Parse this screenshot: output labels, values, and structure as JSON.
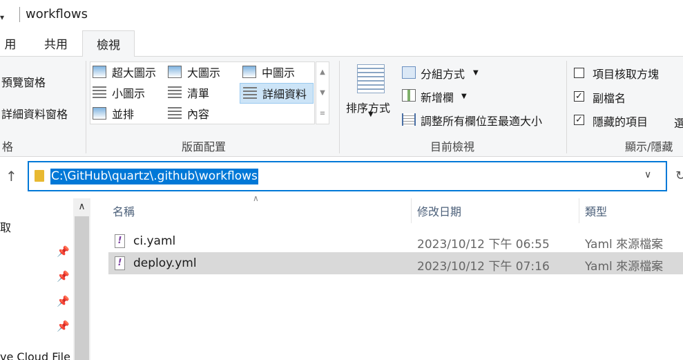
{
  "window": {
    "title": "workflows",
    "qa_dropdown": "▾"
  },
  "tabs": [
    {
      "label": "用"
    },
    {
      "label": "共用"
    },
    {
      "label": "檢視",
      "selected": true
    }
  ],
  "ribbon": {
    "panes": {
      "preview_pane": "預覽窗格",
      "details_pane": "詳細資料窗格",
      "group_label": "格"
    },
    "layout": {
      "items": [
        "超大圖示",
        "大圖示",
        "中圖示",
        "小圖示",
        "清單",
        "詳細資料",
        "並排",
        "內容"
      ],
      "selected": "詳細資料",
      "group_label": "版面配置"
    },
    "current_view": {
      "sort_by": "排序方式",
      "group_by": "分組方式",
      "add_columns": "新增欄",
      "size_all_columns": "調整所有欄位至最適大小",
      "group_label": "目前檢視"
    },
    "show_hide": {
      "item_checkboxes": {
        "label": "項目核取方塊",
        "checked": false
      },
      "file_name_extensions": {
        "label": "副檔名",
        "checked": true
      },
      "hidden_items": {
        "label": "隱藏的項目",
        "checked": true
      },
      "partial_label": "選",
      "group_label": "顯示/隱藏"
    }
  },
  "address_bar": {
    "path": "C:\\GitHub\\quartz\\.github\\workflows"
  },
  "nav_pane": {
    "partial_item": "取",
    "cloud_item": "ve Cloud File"
  },
  "file_list": {
    "columns": [
      "名稱",
      "修改日期",
      "類型"
    ],
    "rows": [
      {
        "name": "ci.yaml",
        "modified": "2023/10/12 下午 06:55",
        "type": "Yaml 來源檔案"
      },
      {
        "name": "deploy.yml",
        "modified": "2023/10/12 下午 07:16",
        "type": "Yaml 來源檔案",
        "selected": true
      }
    ]
  },
  "colors": {
    "accent": "#0078d7",
    "selection": "#cce4f7",
    "row_highlight": "#d9d9d9"
  }
}
